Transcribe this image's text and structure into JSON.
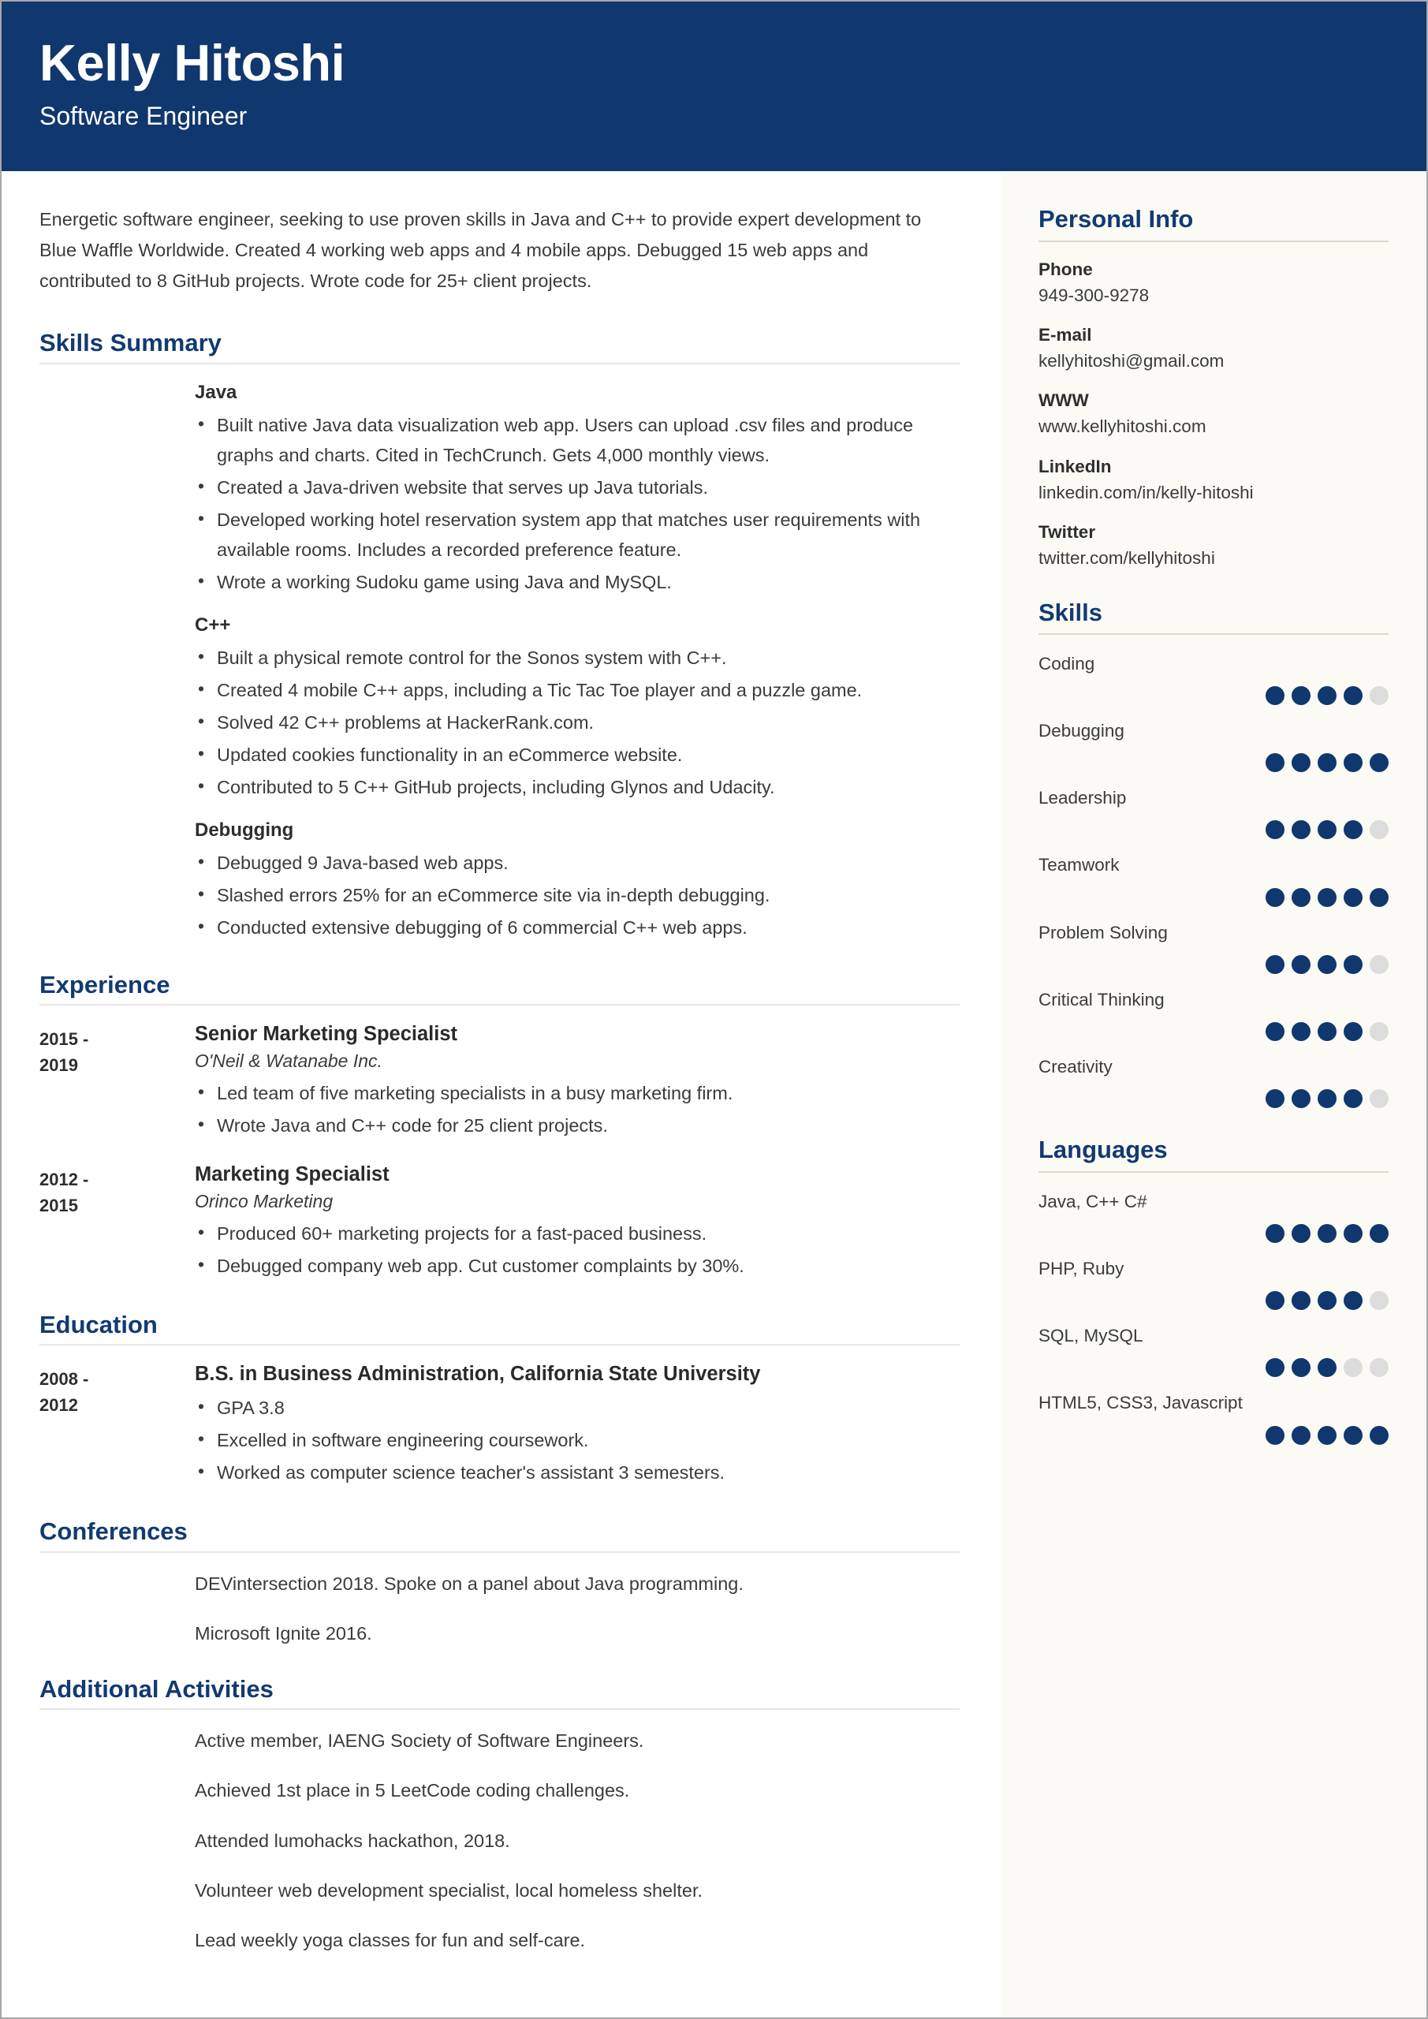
{
  "colors": {
    "navy": "#10376e",
    "heading_navy": "#123a72",
    "sidebar_bg": "#fbfaf5",
    "dot_filled": "#10376e",
    "dot_empty": "#dcdcdc",
    "body_text": "#3b3b3b"
  },
  "header": {
    "name": "Kelly Hitoshi",
    "role": "Software Engineer"
  },
  "summary": "Energetic software engineer, seeking to use proven skills in Java and C++ to provide expert development to Blue Waffle Worldwide. Created 4 working web apps and 4 mobile apps. Debugged 15 web apps and contributed to 8 GitHub projects. Wrote code for 25+ client projects.",
  "sections": {
    "skills_summary": {
      "title": "Skills Summary",
      "groups": [
        {
          "name": "Java",
          "bullets": [
            "Built native Java data visualization web app. Users can upload .csv files and produce graphs and charts. Cited in TechCrunch. Gets 4,000 monthly views.",
            "Created a Java-driven website that serves up Java tutorials.",
            "Developed working hotel reservation system app that matches user requirements with available rooms. Includes a recorded preference feature.",
            "Wrote a working Sudoku game using Java and MySQL."
          ]
        },
        {
          "name": "C++",
          "bullets": [
            "Built a physical remote control for the Sonos system with C++.",
            "Created 4 mobile C++ apps, including a Tic Tac Toe player and a puzzle game.",
            "Solved 42 C++ problems at HackerRank.com.",
            "Updated cookies functionality in an eCommerce website.",
            "Contributed to 5 C++ GitHub projects, including Glynos and Udacity."
          ]
        },
        {
          "name": "Debugging",
          "bullets": [
            "Debugged 9 Java-based web apps.",
            "Slashed errors 25% for an eCommerce site via in-depth debugging.",
            "Conducted extensive debugging of 6 commercial C++ web apps."
          ]
        }
      ]
    },
    "experience": {
      "title": "Experience",
      "entries": [
        {
          "date_from": "2015 -",
          "date_to": "2019",
          "title": "Senior Marketing Specialist",
          "org": "O'Neil & Watanabe Inc.",
          "bullets": [
            "Led team of five marketing specialists in a busy marketing firm.",
            "Wrote Java and C++ code for 25 client projects."
          ]
        },
        {
          "date_from": "2012 -",
          "date_to": "2015",
          "title": "Marketing Specialist",
          "org": "Orinco Marketing",
          "bullets": [
            "Produced 60+ marketing projects for a fast-paced business.",
            "Debugged company web app. Cut customer complaints by 30%."
          ]
        }
      ]
    },
    "education": {
      "title": "Education",
      "entries": [
        {
          "date_from": "2008 -",
          "date_to": "2012",
          "title": "B.S. in Business Administration, California State University",
          "bullets": [
            "GPA 3.8",
            "Excelled in software engineering coursework.",
            "Worked as computer science teacher's assistant 3 semesters."
          ]
        }
      ]
    },
    "conferences": {
      "title": "Conferences",
      "lines": [
        "DEVintersection 2018. Spoke on a panel about Java programming.",
        "Microsoft Ignite 2016."
      ]
    },
    "additional_activities": {
      "title": "Additional Activities",
      "lines": [
        "Active member, IAENG Society of Software Engineers.",
        "Achieved 1st place in 5 LeetCode coding challenges.",
        "Attended lumohacks hackathon, 2018.",
        "Volunteer web development specialist, local homeless shelter.",
        "Lead weekly yoga classes for fun and self-care."
      ]
    }
  },
  "sidebar": {
    "personal_info": {
      "title": "Personal Info",
      "items": [
        {
          "label": "Phone",
          "value": "949-300-9278"
        },
        {
          "label": "E-mail",
          "value": "kellyhitoshi@gmail.com"
        },
        {
          "label": "WWW",
          "value": "www.kellyhitoshi.com"
        },
        {
          "label": "LinkedIn",
          "value": "linkedin.com/in/kelly-hitoshi"
        },
        {
          "label": "Twitter",
          "value": "twitter.com/kellyhitoshi"
        }
      ]
    },
    "skills": {
      "title": "Skills",
      "max": 5,
      "items": [
        {
          "label": "Coding",
          "rating": 4
        },
        {
          "label": "Debugging",
          "rating": 5
        },
        {
          "label": "Leadership",
          "rating": 4
        },
        {
          "label": "Teamwork",
          "rating": 5
        },
        {
          "label": "Problem Solving",
          "rating": 4
        },
        {
          "label": "Critical Thinking",
          "rating": 4
        },
        {
          "label": "Creativity",
          "rating": 4
        }
      ]
    },
    "languages": {
      "title": "Languages",
      "max": 5,
      "items": [
        {
          "label": "Java, C++ C#",
          "rating": 5
        },
        {
          "label": "PHP, Ruby",
          "rating": 4
        },
        {
          "label": "SQL, MySQL",
          "rating": 3
        },
        {
          "label": "HTML5, CSS3, Javascript",
          "rating": 5
        }
      ]
    }
  }
}
